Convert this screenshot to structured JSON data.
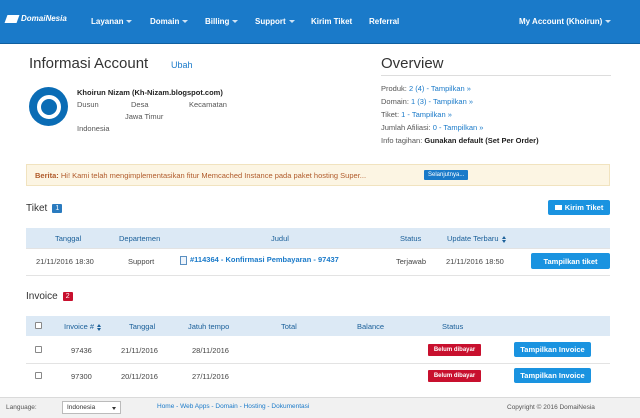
{
  "nav": {
    "logo_text": "DomaiNesia",
    "items": [
      "Layanan",
      "Domain",
      "Billing",
      "Support",
      "Kirim Tiket",
      "Referral"
    ],
    "account": "My Account (Khoirun)"
  },
  "account": {
    "title": "Informasi Account",
    "edit_label": "Ubah",
    "name": "Khoirun Nizam (Kh-Nizam.blogspot.com)",
    "dusun": "Dusun",
    "desa": "Desa",
    "kecamatan": "Kecamatan",
    "provinsi": "Jawa Timur",
    "negara": "Indonesia"
  },
  "overview": {
    "title": "Overview",
    "produk_label": "Produk:",
    "produk_value": "2 (4) - Tampilkan »",
    "domain_label": "Domain:",
    "domain_value": "1 (3) - Tampilkan »",
    "tiket_label": "Tiket:",
    "tiket_value": "1 - Tampilkan »",
    "afiliasi_label": "Jumlah Afiliasi:",
    "afiliasi_value": "0 - Tampilkan »",
    "tagihan_label": "Info tagihan:",
    "tagihan_value": "Gunakan default (Set Per Order)"
  },
  "banner": {
    "label": "Berita:",
    "text": "Hi! Kami telah mengimplementasikan fitur Memcached Instance pada paket hosting Super...",
    "button": "Selanjutnya..."
  },
  "tickets": {
    "title": "Tiket",
    "count": "1",
    "send_button": "Kirim Tiket",
    "headers": [
      "Tanggal",
      "Departemen",
      "Judul",
      "Status",
      "Update Terbaru"
    ],
    "rows": [
      {
        "tanggal": "21/11/2016 18:30",
        "departemen": "Support",
        "judul": "#114364 - Konfirmasi Pembayaran - 97437",
        "status": "Terjawab",
        "update": "21/11/2016 18:50",
        "action": "Tampilkan tiket"
      }
    ]
  },
  "invoices": {
    "title": "Invoice",
    "count": "2",
    "headers": [
      "Invoice #",
      "Tanggal",
      "Jatuh tempo",
      "Total",
      "Balance",
      "Status"
    ],
    "rows": [
      {
        "id": "97436",
        "tanggal": "21/11/2016",
        "jatuh_tempo": "28/11/2016",
        "status": "Belum dibayar",
        "action": "Tampilkan Invoice"
      },
      {
        "id": "97300",
        "tanggal": "20/11/2016",
        "jatuh_tempo": "27/11/2016",
        "status": "Belum dibayar",
        "action": "Tampilkan Invoice"
      }
    ]
  },
  "footer": {
    "language_label": "Language:",
    "language_value": "Indonesia",
    "links": "Home - Web Apps - Domain - Hosting - Dokumentasi",
    "copyright": "Copyright © 2016 DomaiNesia"
  },
  "colors": {
    "nav": "#1a7ac9",
    "button": "#1a93e0",
    "unpaid": "#c8102e",
    "table_header": "#dce9f5",
    "banner_bg": "#fcf5e3"
  }
}
